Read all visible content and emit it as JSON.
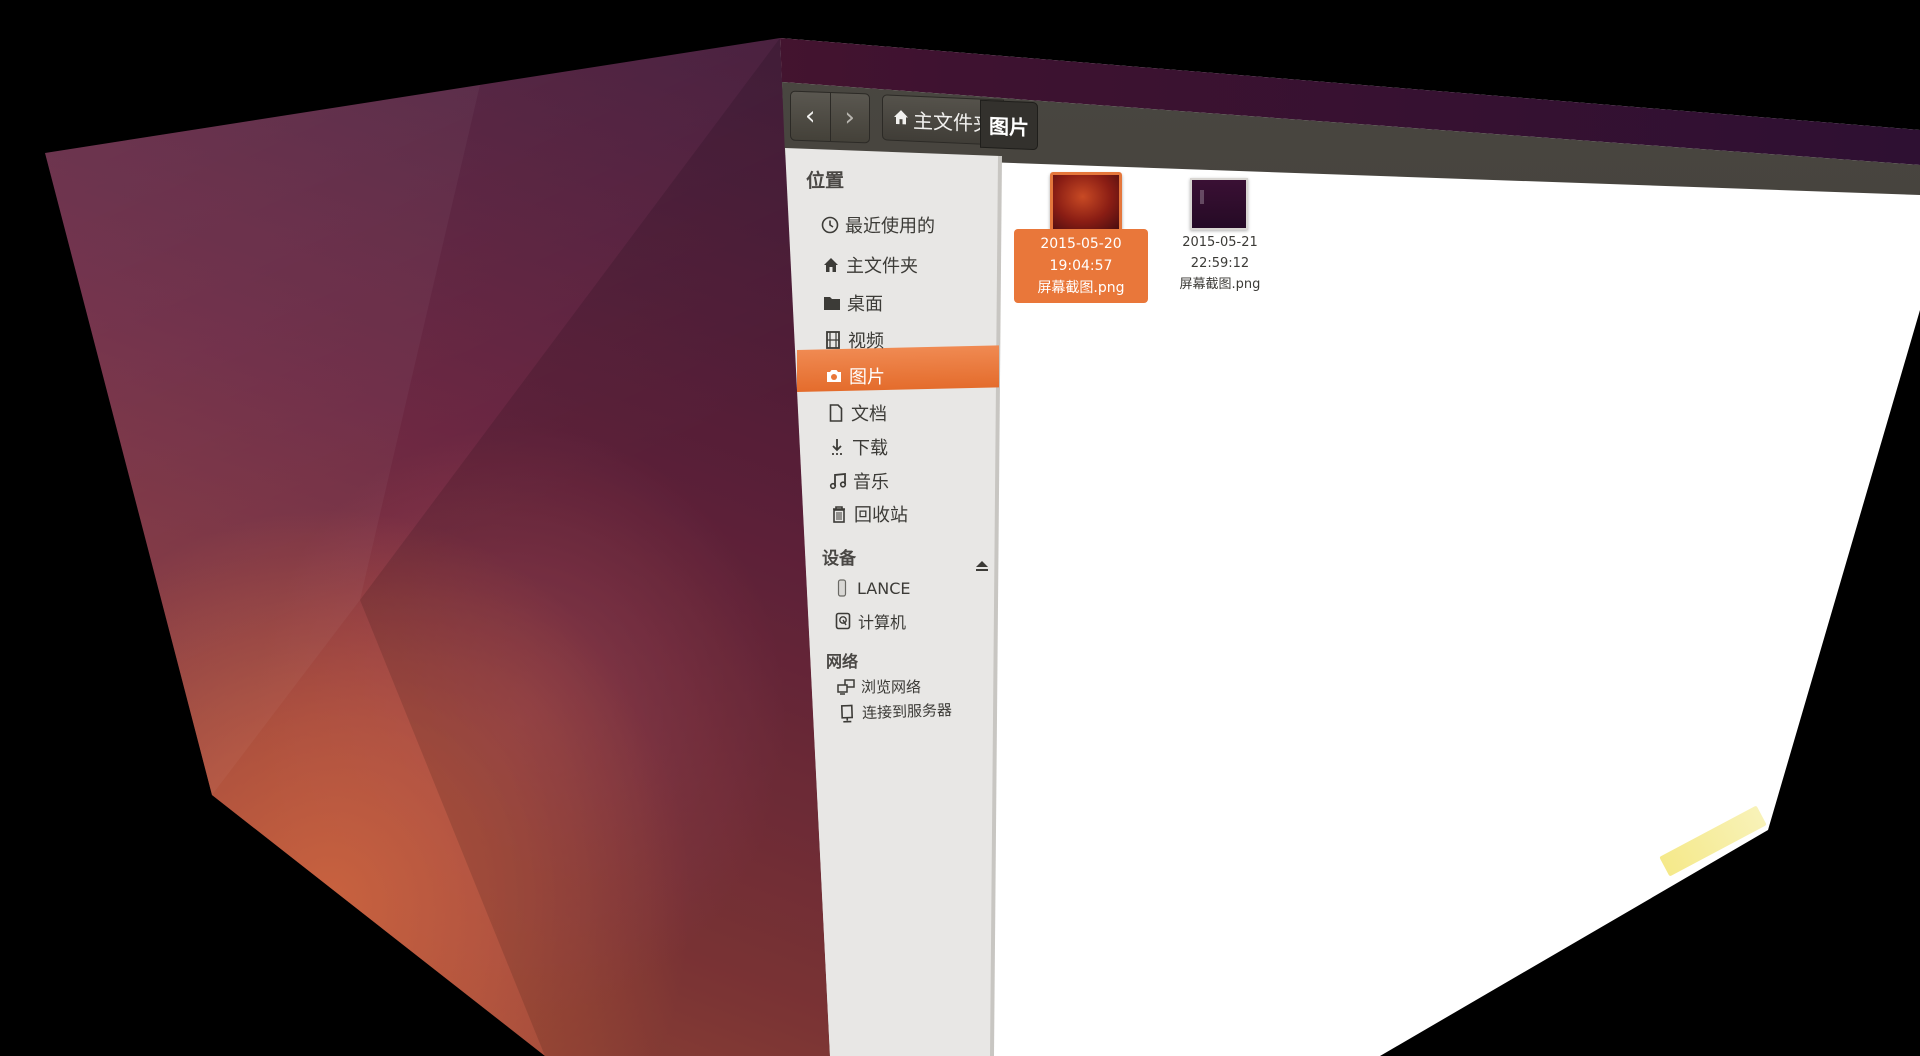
{
  "toolbar": {
    "back_icon": "chevron-left-icon",
    "forward_icon": "chevron-right-icon",
    "breadcrumb": {
      "home_label": "主文件夹",
      "current_label": "图片"
    }
  },
  "sidebar": {
    "places_heading": "位置",
    "places": [
      {
        "label": "最近使用的",
        "icon": "clock-icon"
      },
      {
        "label": "主文件夹",
        "icon": "home-icon"
      },
      {
        "label": "桌面",
        "icon": "folder-icon"
      },
      {
        "label": "视频",
        "icon": "film-icon"
      },
      {
        "label": "图片",
        "icon": "camera-icon",
        "selected": true
      },
      {
        "label": "文档",
        "icon": "document-icon"
      },
      {
        "label": "下载",
        "icon": "download-icon"
      },
      {
        "label": "音乐",
        "icon": "music-icon"
      },
      {
        "label": "回收站",
        "icon": "trash-icon"
      }
    ],
    "devices_heading": "设备",
    "devices": [
      {
        "label": "LANCE",
        "icon": "usb-drive-icon",
        "eject": true
      },
      {
        "label": "计算机",
        "icon": "harddisk-icon"
      }
    ],
    "network_heading": "网络",
    "network": [
      {
        "label": "浏览网络",
        "icon": "network-icon"
      },
      {
        "label": "连接到服务器",
        "icon": "server-icon"
      }
    ]
  },
  "files": [
    {
      "line1": "2015-05-20 19:04:57",
      "line2": "屏幕截图.png",
      "selected": true
    },
    {
      "line1": "2015-05-21 22:59:12",
      "line2": "屏幕截图.png",
      "selected": false
    }
  ],
  "colors": {
    "accent": "#e9773a",
    "toolbar": "#3e3c37",
    "sidebar_bg": "#e8e7e5"
  }
}
